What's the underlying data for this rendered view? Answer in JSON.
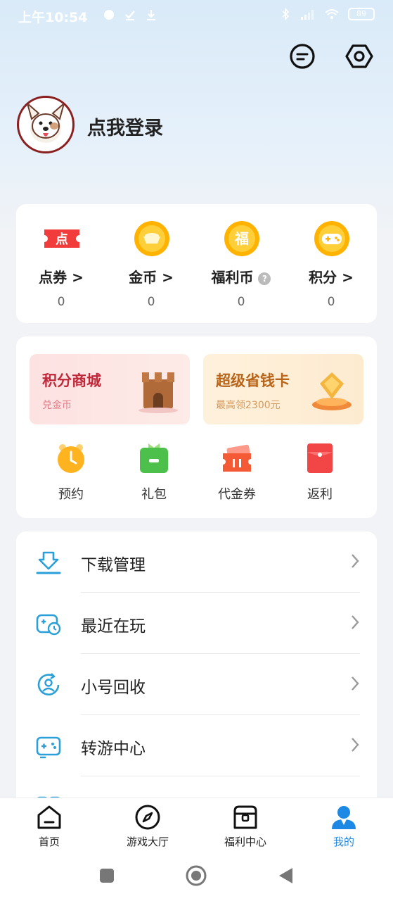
{
  "status_bar": {
    "time": "上午10:54",
    "battery": "89"
  },
  "header": {
    "login_text": "点我登录"
  },
  "assets": [
    {
      "label": "点券 >",
      "value": "0",
      "icon": "ticket-icon"
    },
    {
      "label": "金币 >",
      "value": "0",
      "icon": "gold-coin-icon"
    },
    {
      "label": "福利币",
      "value": "0",
      "icon": "fu-coin-icon",
      "icon_text": "福",
      "help": "?"
    },
    {
      "label": "积分 >",
      "value": "0",
      "icon": "gamepad-points-icon"
    }
  ],
  "ticket_icon_text": "点",
  "banners": [
    {
      "title": "积分商城",
      "subtitle": "兑金币",
      "title_color": "#c0283a",
      "sub_color": "#e07a86"
    },
    {
      "title": "超级省钱卡",
      "subtitle": "最高领2300元",
      "title_color": "#b8651a",
      "sub_color": "#d59a5c"
    }
  ],
  "quick_actions": [
    {
      "label": "预约",
      "icon": "alarm-clock-icon"
    },
    {
      "label": "礼包",
      "icon": "gift-bag-icon"
    },
    {
      "label": "代金券",
      "icon": "voucher-icon"
    },
    {
      "label": "返利",
      "icon": "red-envelope-icon"
    }
  ],
  "menu": [
    {
      "label": "下载管理",
      "icon": "download-icon"
    },
    {
      "label": "最近在玩",
      "icon": "recent-game-icon"
    },
    {
      "label": "小号回收",
      "icon": "account-recycle-icon"
    },
    {
      "label": "转游中心",
      "icon": "transfer-game-icon"
    }
  ],
  "tabs": [
    {
      "label": "首页",
      "icon": "home-icon",
      "active": false
    },
    {
      "label": "游戏大厅",
      "icon": "compass-icon",
      "active": false
    },
    {
      "label": "福利中心",
      "icon": "treasure-chest-icon",
      "active": false
    },
    {
      "label": "我的",
      "icon": "user-icon",
      "active": true
    }
  ],
  "colors": {
    "accent": "#1e88e5",
    "menu_icon": "#2a9fd8",
    "card_bg": "#ffffff"
  }
}
